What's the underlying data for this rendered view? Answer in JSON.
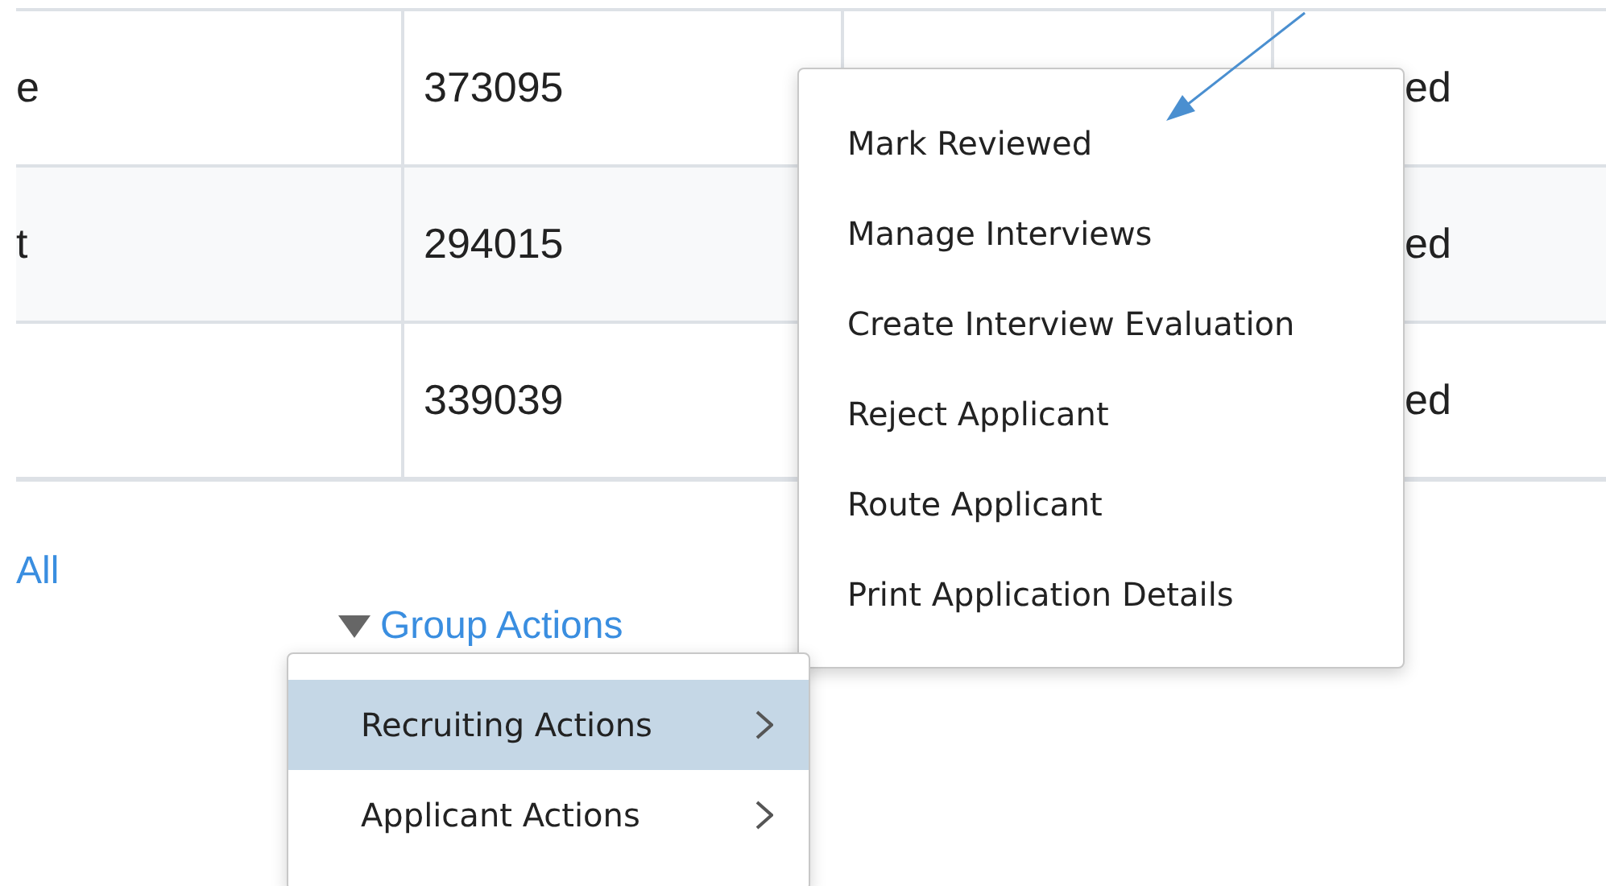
{
  "table": {
    "rows": [
      {
        "column_1": "e",
        "column_2": "373095",
        "column_4": "ed"
      },
      {
        "column_1": "t",
        "column_2": "294015",
        "column_4": "ed"
      },
      {
        "column_2": "339039",
        "column_4": "ed"
      }
    ]
  },
  "select_all_link": "All",
  "group_actions": {
    "label": "Group Actions",
    "expanded": true
  },
  "group_menu": {
    "items": [
      {
        "label": "Recruiting Actions",
        "selected": true,
        "has_submenu": true
      },
      {
        "label": "Applicant Actions",
        "selected": false,
        "has_submenu": true
      }
    ]
  },
  "actions_menu": {
    "items": [
      {
        "label": "Mark Reviewed",
        "selected": false
      },
      {
        "label": "Manage Interviews",
        "selected": false
      },
      {
        "label": "Create Interview Evaluation",
        "selected": false
      },
      {
        "label": "Reject Applicant",
        "selected": false
      },
      {
        "label": "Route Applicant",
        "selected": false
      },
      {
        "label": "Print Application Details",
        "selected": false
      }
    ]
  }
}
